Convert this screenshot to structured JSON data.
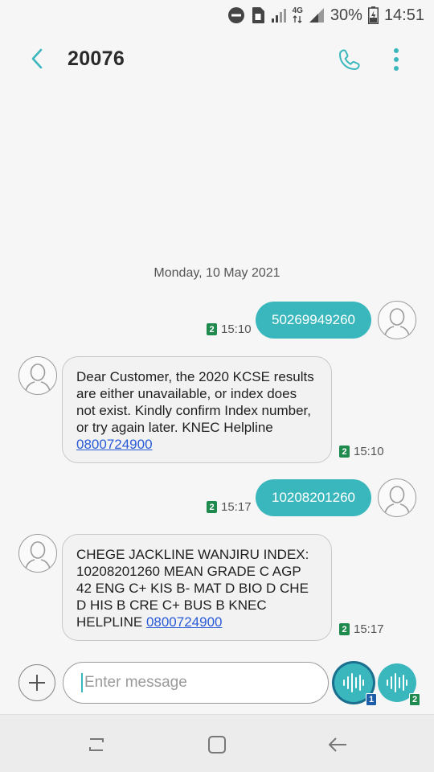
{
  "status_bar": {
    "network_label": "4G",
    "battery": "30%",
    "time": "14:51"
  },
  "header": {
    "title": "20076",
    "back_icon": "back-arrow-icon",
    "call_icon": "phone-icon",
    "more_icon": "more-vert-icon"
  },
  "conversation": {
    "date": "Monday, 10 May 2021",
    "messages": [
      {
        "direction": "outgoing",
        "text": "50269949260",
        "sim": "2",
        "time": "15:10"
      },
      {
        "direction": "incoming",
        "text": "Dear Customer, the 2020 KCSE results are either unavailable, or index does not exist. Kindly confirm Index number, or try again later. KNEC Helpline ",
        "link": "0800724900",
        "sim": "2",
        "time": "15:10"
      },
      {
        "direction": "outgoing",
        "text": "10208201260",
        "sim": "2",
        "time": "15:17"
      },
      {
        "direction": "incoming",
        "text": "CHEGE JACKLINE WANJIRU INDEX: 10208201260 MEAN GRADE C AGP 42 ENG C+ KIS B- MAT D BIO D CHE D HIS B CRE C+ BUS B  KNEC HELPLINE ",
        "link": "0800724900",
        "sim": "2",
        "time": "15:17"
      }
    ]
  },
  "composer": {
    "placeholder": "Enter message",
    "send_sim1_label": "1",
    "send_sim2_label": "2"
  },
  "colors": {
    "accent": "#3ab7bd",
    "sim_badge": "#1f8a4d",
    "sim1_badge": "#1e5ea8",
    "link": "#2a5bd7"
  }
}
